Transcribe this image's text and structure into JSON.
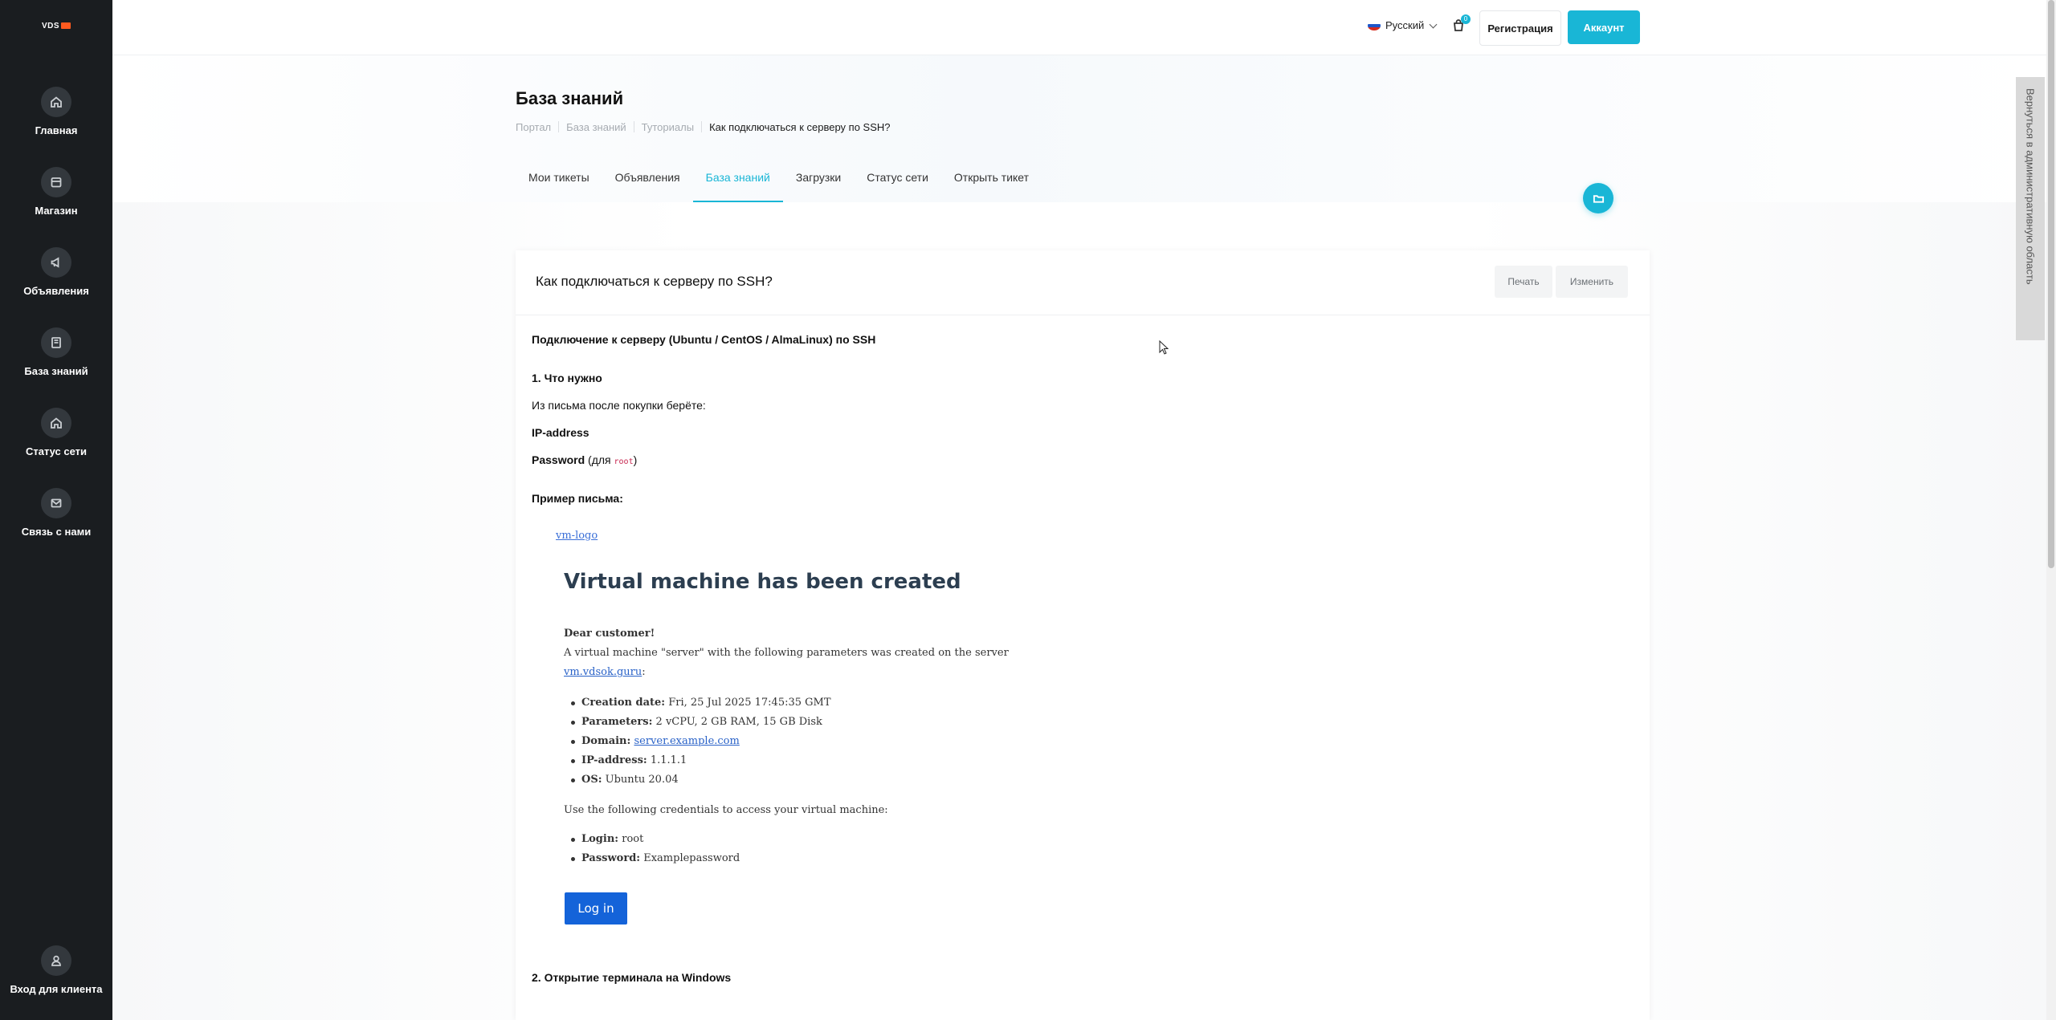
{
  "brand": {
    "logo_text": "VDS"
  },
  "sidebar": {
    "items": [
      {
        "label": "Главная",
        "icon": "home-icon"
      },
      {
        "label": "Магазин",
        "icon": "store-icon"
      },
      {
        "label": "Объявления",
        "icon": "megaphone-icon"
      },
      {
        "label": "База знаний",
        "icon": "book-icon"
      },
      {
        "label": "Статус сети",
        "icon": "home-icon"
      },
      {
        "label": "Связь с нами",
        "icon": "mail-icon"
      }
    ],
    "login": {
      "label": "Вход для клиента",
      "icon": "user-icon"
    }
  },
  "topbar": {
    "language": "Русский",
    "cart_count": "0",
    "register_label": "Регистрация",
    "account_label": "Аккаунт"
  },
  "page": {
    "title": "База знаний",
    "breadcrumb": [
      "Портал",
      "База знаний",
      "Туториалы",
      "Как подключаться к серверу по SSH?"
    ],
    "tabs": [
      "Мои тикеты",
      "Объявления",
      "База знаний",
      "Загрузки",
      "Статус сети",
      "Открыть тикет"
    ],
    "active_tab": "База знаний"
  },
  "article": {
    "title": "Как подключаться к серверу по SSH?",
    "print_label": "Печать",
    "edit_label": "Изменить",
    "heading": "Подключение к серверу (Ubuntu / CentOS / AlmaLinux) по SSH",
    "section1": "1. Что нужно",
    "from_email": "Из письма после покупки берёте:",
    "ip_label": "IP-address",
    "password_prefix": "Password",
    "password_paren_open": " (для ",
    "password_code": "root",
    "password_paren_close": ")",
    "example_label": "Пример письма:",
    "section2": "2. Открытие терминала на Windows"
  },
  "email": {
    "logo_alt": "vm-logo",
    "title": "Virtual machine has been created",
    "greeting": "Dear customer!",
    "intro": "A virtual machine \"server\" with the following parameters was created on the server",
    "server_link": "vm.vdsok.guru",
    "params": [
      {
        "label": "Creation date:",
        "value": " Fri, 25 Jul 2025 17:45:35 GMT"
      },
      {
        "label": "Parameters:",
        "value": " 2 vCPU, 2 GB RAM, 15 GB Disk"
      },
      {
        "label": "Domain:",
        "value": "server.example.com"
      },
      {
        "label": "IP-address:",
        "value": " 1.1.1.1"
      },
      {
        "label": "OS:",
        "value": " Ubuntu 20.04"
      }
    ],
    "creds_intro": "Use the following credentials to access your virtual machine:",
    "creds": [
      {
        "label": "Login:",
        "value": " root"
      },
      {
        "label": "Password:",
        "value": " Examplepassword"
      }
    ],
    "login_button": "Log in"
  },
  "side_tab": {
    "label": "Вернуться в административную область"
  },
  "colors": {
    "accent": "#19b6d6",
    "sidebar_bg": "#1a1d20",
    "email_button": "#1463d9"
  }
}
